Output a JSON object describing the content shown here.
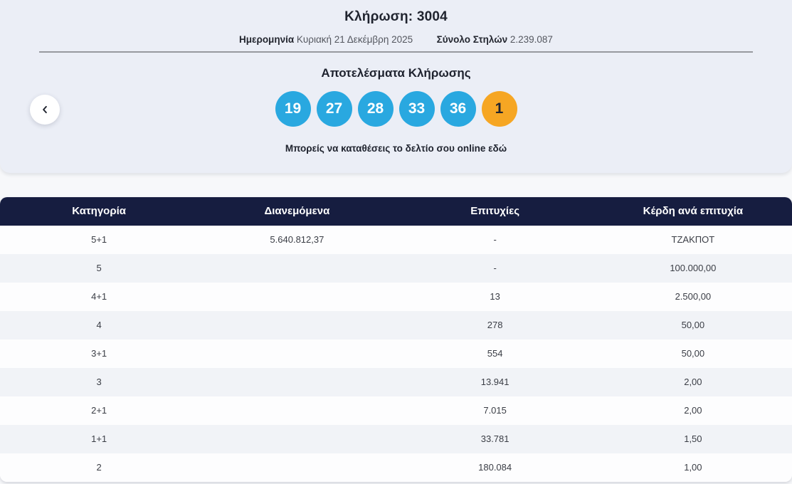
{
  "hero": {
    "draw_label": "Κλήρωση:",
    "draw_number": "3004",
    "date_label": "Ημερομηνία",
    "date_value": "Κυριακή 21 Δεκέμβρη 2025",
    "columns_label": "Σύνολο Στηλών",
    "columns_value": "2.239.087",
    "results_heading": "Αποτελέσματα Κλήρωσης",
    "numbers": [
      "19",
      "27",
      "28",
      "33",
      "36"
    ],
    "joker_number": "1",
    "note_text": "Μπορείς να καταθέσεις το δελτίο σου",
    "note_link": "online εδώ",
    "back_icon": "chevron-left-icon"
  },
  "colors": {
    "number_ball_blue": "#29a8e0",
    "joker_ball_orange": "#f6a623",
    "table_header_navy": "#161d40",
    "hero_background": "#ebeef6",
    "row_alt_gray": "#f1f3f7"
  },
  "table": {
    "headers": [
      "Κατηγορία",
      "Διανεμόμενα",
      "Επιτυχίες",
      "Κέρδη ανά επιτυχία"
    ],
    "rows": [
      {
        "category": "5+1",
        "distributed": "5.640.812,37",
        "winners": "-",
        "payout": "ΤΖΑΚΠΟΤ"
      },
      {
        "category": "5",
        "distributed": "",
        "winners": "-",
        "payout": "100.000,00"
      },
      {
        "category": "4+1",
        "distributed": "",
        "winners": "13",
        "payout": "2.500,00"
      },
      {
        "category": "4",
        "distributed": "",
        "winners": "278",
        "payout": "50,00"
      },
      {
        "category": "3+1",
        "distributed": "",
        "winners": "554",
        "payout": "50,00"
      },
      {
        "category": "3",
        "distributed": "",
        "winners": "13.941",
        "payout": "2,00"
      },
      {
        "category": "2+1",
        "distributed": "",
        "winners": "7.015",
        "payout": "2,00"
      },
      {
        "category": "1+1",
        "distributed": "",
        "winners": "33.781",
        "payout": "1,50"
      },
      {
        "category": "2",
        "distributed": "",
        "winners": "180.084",
        "payout": "1,00"
      }
    ]
  }
}
